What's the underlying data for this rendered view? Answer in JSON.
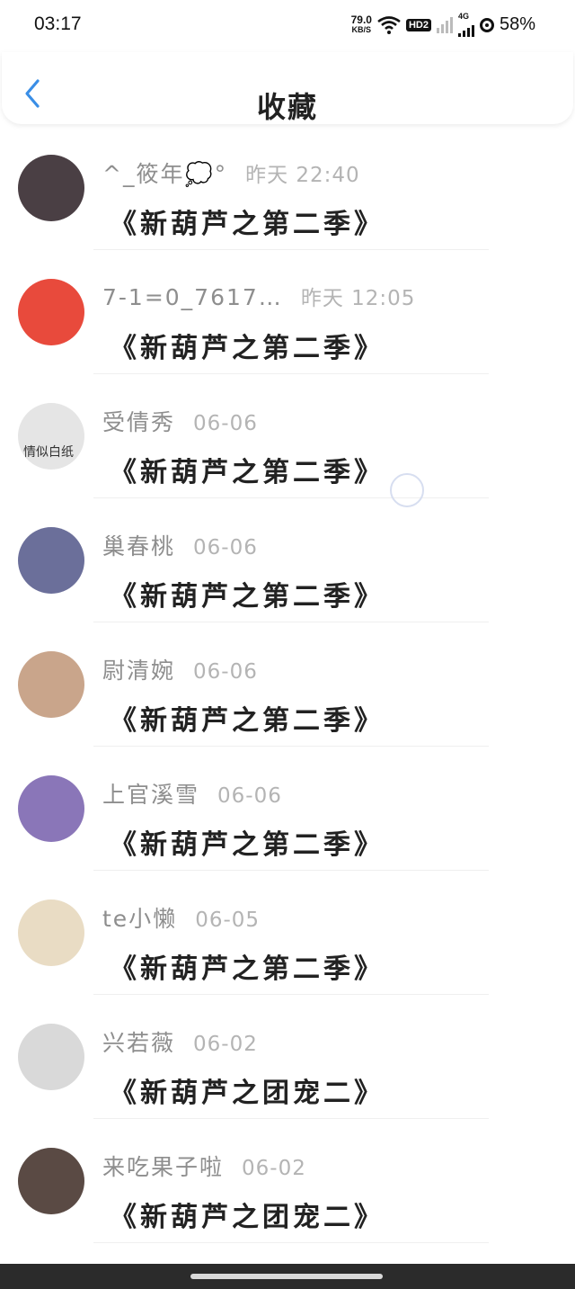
{
  "status_bar": {
    "time": "03:17",
    "net_speed": "79.0",
    "net_unit": "KB/S",
    "hd_badge": "HD2",
    "net_type": "4G",
    "battery": "58%"
  },
  "header": {
    "title": "收藏",
    "accent": "#3a8ee6"
  },
  "items": [
    {
      "name": "^_筱年💭°",
      "time": "昨天 22:40",
      "title": "《新葫芦之第二季》",
      "avatar_color": "#4a3f44"
    },
    {
      "name": "7-1=0_7617…",
      "time": "昨天 12:05",
      "title": "《新葫芦之第二季》",
      "avatar_color": "#e84a3c"
    },
    {
      "name": "受倩秀",
      "time": "06-06",
      "title": "《新葫芦之第二季》",
      "avatar_color": "#e5e5e5",
      "avatar_text": "情似白纸"
    },
    {
      "name": "巢春桃",
      "time": "06-06",
      "title": "《新葫芦之第二季》",
      "avatar_color": "#6b6f9a"
    },
    {
      "name": "尉清婉",
      "time": "06-06",
      "title": "《新葫芦之第二季》",
      "avatar_color": "#c9a58b"
    },
    {
      "name": "上官溪雪",
      "time": "06-06",
      "title": "《新葫芦之第二季》",
      "avatar_color": "#8a76b8"
    },
    {
      "name": "te小懒",
      "time": "06-05",
      "title": "《新葫芦之第二季》",
      "avatar_color": "#e9dcc4"
    },
    {
      "name": "兴若薇",
      "time": "06-02",
      "title": "《新葫芦之团宠二》",
      "avatar_color": "#d9d9d9"
    },
    {
      "name": "来吃果子啦",
      "time": "06-02",
      "title": "《新葫芦之团宠二》",
      "avatar_color": "#5a4a44"
    }
  ]
}
